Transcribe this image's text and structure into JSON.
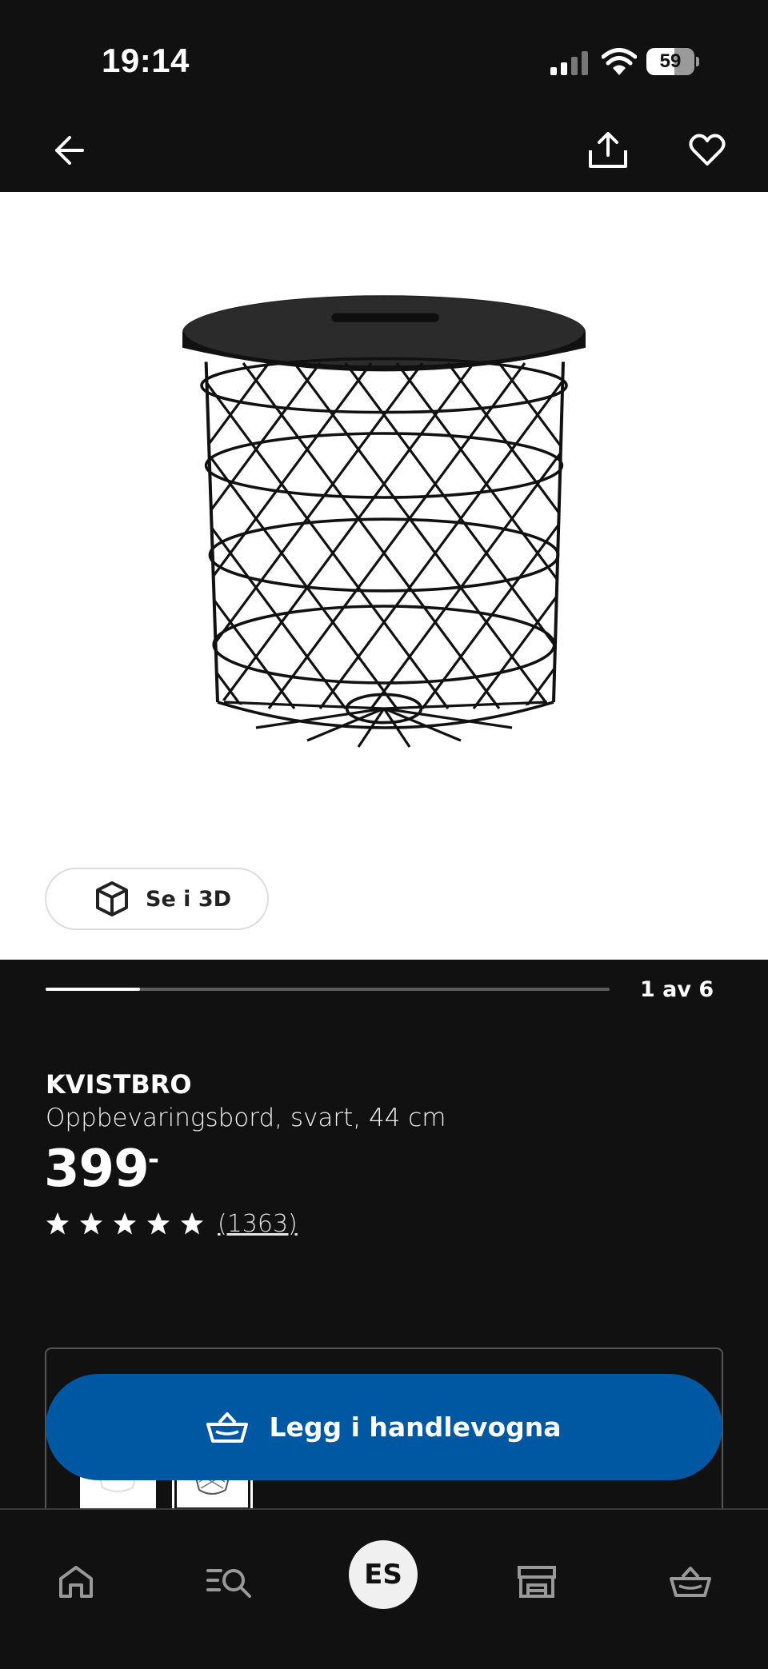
{
  "status_bar": {
    "time": "19:14",
    "battery": "59",
    "battery_level": 0.59
  },
  "nav": {
    "back_icon": "arrow-left-icon",
    "share_icon": "share-icon",
    "favorite_icon": "heart-icon"
  },
  "gallery": {
    "view_3d_label": "Se i 3D",
    "counter": "1 av 6",
    "current_index": 1,
    "total_images": 6
  },
  "product": {
    "name": "KVISTBRO",
    "description": "Oppbevaringsbord, svart, 44 cm",
    "price": "399",
    "price_suffix": ",-",
    "rating": 5,
    "rating_max": 5,
    "review_count": "(1363)"
  },
  "cart_button": {
    "label": "Legg i handlevogna"
  },
  "tab_bar": {
    "items": [
      {
        "icon": "home-icon"
      },
      {
        "icon": "search-list-icon"
      },
      {
        "avatar_initials": "ES"
      },
      {
        "icon": "store-icon"
      },
      {
        "icon": "basket-icon"
      }
    ]
  },
  "colors": {
    "background": "#111111",
    "accent": "#0058a3",
    "white": "#ffffff"
  }
}
